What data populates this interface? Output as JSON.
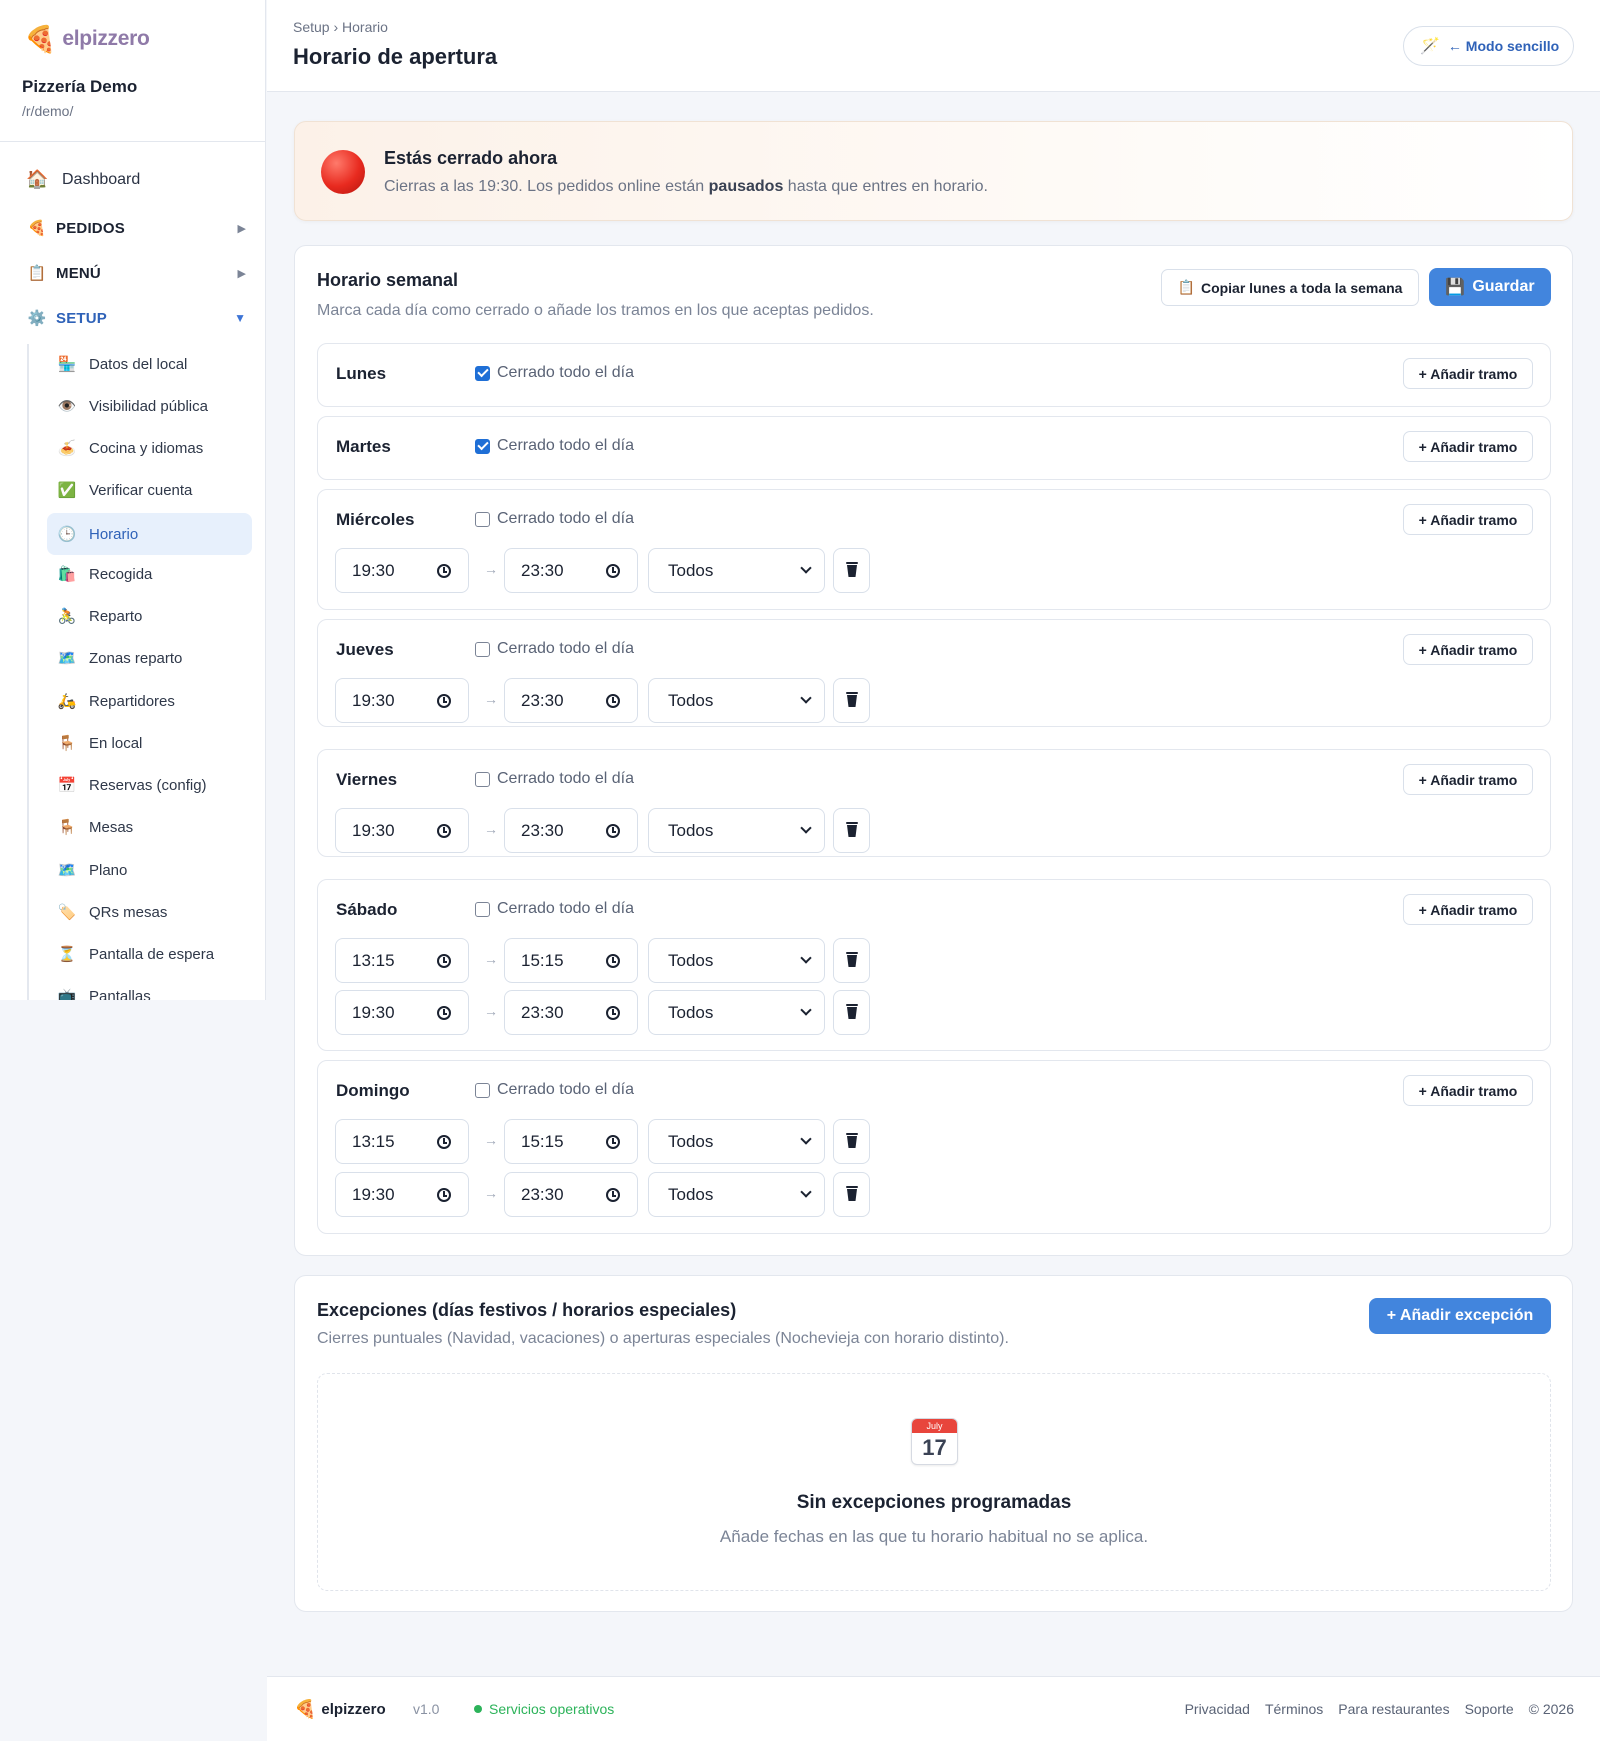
{
  "brand": {
    "name": "elpizzero",
    "logo_icon": "🍕"
  },
  "restaurant": {
    "name": "Pizzería Demo",
    "path": "/r/demo/"
  },
  "sidebar": {
    "dashboard": {
      "icon": "🏠",
      "label": "Dashboard"
    },
    "groups": [
      {
        "icon": "🍕",
        "label": "PEDIDOS",
        "chevron": "▶"
      },
      {
        "icon": "📋",
        "label": "MENÚ",
        "chevron": "▶"
      },
      {
        "icon": "⚙️",
        "label": "SETUP",
        "chevron": "▼"
      }
    ],
    "setup_items": [
      {
        "icon": "🏪",
        "label": "Datos del local"
      },
      {
        "icon": "👁️",
        "label": "Visibilidad pública"
      },
      {
        "icon": "🍝",
        "label": "Cocina y idiomas"
      },
      {
        "icon": "✅",
        "label": "Verificar cuenta"
      },
      {
        "icon": "🕒",
        "label": "Horario",
        "active": true
      },
      {
        "icon": "🛍️",
        "label": "Recogida"
      },
      {
        "icon": "🚴",
        "label": "Reparto"
      },
      {
        "icon": "🗺️",
        "label": "Zonas reparto"
      },
      {
        "icon": "🛵",
        "label": "Repartidores"
      },
      {
        "icon": "🪑",
        "label": "En local"
      },
      {
        "icon": "📅",
        "label": "Reservas (config)"
      },
      {
        "icon": "🪑",
        "label": "Mesas"
      },
      {
        "icon": "🗺️",
        "label": "Plano"
      },
      {
        "icon": "🏷️",
        "label": "QRs mesas"
      },
      {
        "icon": "⏳",
        "label": "Pantalla de espera"
      },
      {
        "icon": "📺",
        "label": "Pantallas"
      }
    ]
  },
  "header": {
    "breadcrumb": "Setup › Horario",
    "title": "Horario de apertura",
    "mode_button": {
      "icon": "🪄",
      "label": "← Modo sencillo"
    }
  },
  "status": {
    "title": "Estás cerrado ahora",
    "text_before": "Cierras a las 19:30. Los pedidos online están",
    "text_bold": "pausados",
    "text_after": "hasta que entres en horario.",
    "color": "#e82a1f"
  },
  "weekly": {
    "title": "Horario semanal",
    "subtitle": "Marca cada día como cerrado o añade los tramos en los que aceptas pedidos.",
    "copy_button": {
      "icon": "📋",
      "label": "Copiar lunes a toda la semana"
    },
    "save_button": {
      "icon": "💾",
      "label": "Guardar"
    },
    "closed_label": "Cerrado todo el día",
    "add_slot_label": "+ Añadir tramo",
    "arrow": "→",
    "days": [
      {
        "name": "Lunes",
        "closed": true,
        "slots": []
      },
      {
        "name": "Martes",
        "closed": true,
        "slots": []
      },
      {
        "name": "Miércoles",
        "closed": false,
        "slots": [
          {
            "from": "19:30",
            "to": "23:30",
            "service": "Todos"
          }
        ]
      },
      {
        "name": "Jueves",
        "closed": false,
        "slots": [
          {
            "from": "19:30",
            "to": "23:30",
            "service": "Todos"
          }
        ]
      },
      {
        "name": "Viernes",
        "closed": false,
        "slots": [
          {
            "from": "19:30",
            "to": "23:30",
            "service": "Todos"
          }
        ]
      },
      {
        "name": "Sábado",
        "closed": false,
        "slots": [
          {
            "from": "13:15",
            "to": "15:15",
            "service": "Todos"
          },
          {
            "from": "19:30",
            "to": "23:30",
            "service": "Todos"
          }
        ]
      },
      {
        "name": "Domingo",
        "closed": false,
        "slots": [
          {
            "from": "13:15",
            "to": "15:15",
            "service": "Todos"
          },
          {
            "from": "19:30",
            "to": "23:30",
            "service": "Todos"
          }
        ]
      }
    ]
  },
  "exceptions": {
    "title": "Excepciones (días festivos / horarios especiales)",
    "subtitle": "Cierres puntuales (Navidad, vacaciones) o aperturas especiales (Nochevieja con horario distinto).",
    "add_button": "+ Añadir excepción",
    "empty": {
      "calendar_month": "July",
      "calendar_day": "17",
      "title": "Sin excepciones programadas",
      "text": "Añade fechas en las que tu horario habitual no se aplica."
    }
  },
  "footer": {
    "brand": "elpizzero",
    "version": "v1.0",
    "status": "Servicios operativos",
    "status_color": "#2cb35a",
    "links": [
      "Privacidad",
      "Términos",
      "Para restaurantes",
      "Soporte"
    ],
    "copyright": "© 2026"
  },
  "colors": {
    "accent": "#4285dd",
    "active_nav": "#2f62b8"
  }
}
